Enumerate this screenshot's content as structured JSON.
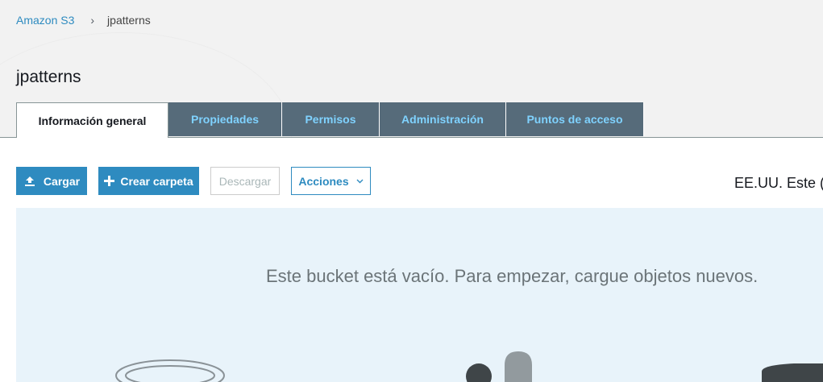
{
  "breadcrumb": {
    "root": "Amazon S3",
    "separator": "›",
    "current": "jpatterns"
  },
  "page": {
    "title": "jpatterns"
  },
  "tabs": [
    {
      "label": "Información general",
      "active": true
    },
    {
      "label": "Propiedades",
      "active": false
    },
    {
      "label": "Permisos",
      "active": false
    },
    {
      "label": "Administración",
      "active": false
    },
    {
      "label": "Puntos de acceso",
      "active": false
    }
  ],
  "toolbar": {
    "upload_label": "Cargar",
    "create_folder_label": "Crear carpeta",
    "download_label": "Descargar",
    "actions_label": "Acciones"
  },
  "region": {
    "label": "EE.UU. Este (N"
  },
  "empty_state": {
    "message": "Este bucket está vacío. Para empezar, cargue objetos nuevos."
  },
  "colors": {
    "accent": "#2e8bc0",
    "tab_bg": "#566b7a",
    "tab_text": "#7fd2ff",
    "empty_bg": "#e8f3fa"
  }
}
